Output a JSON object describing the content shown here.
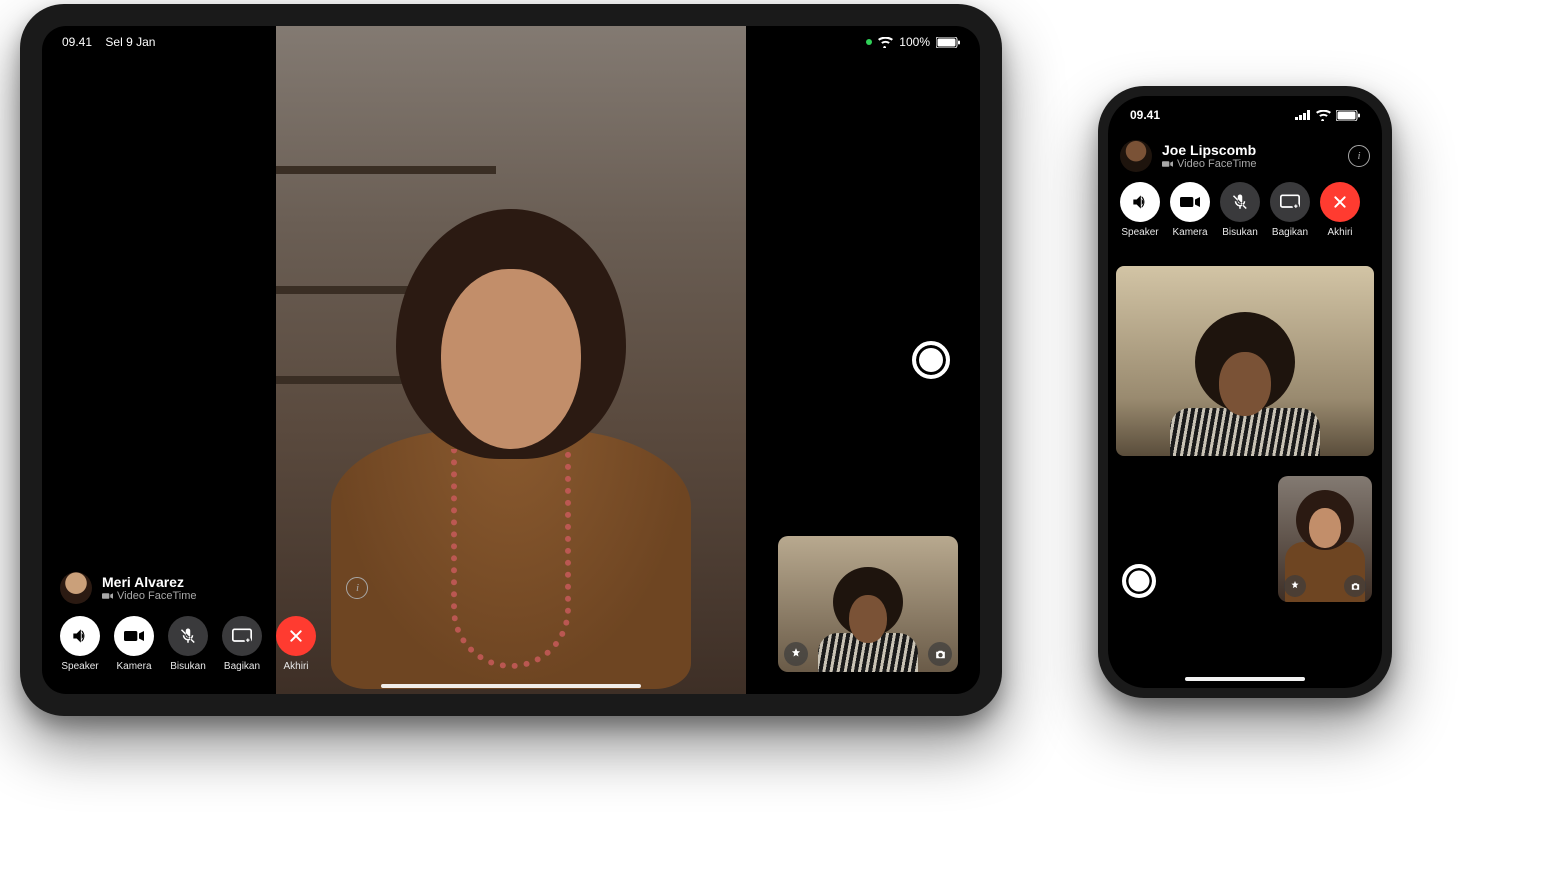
{
  "ipad": {
    "status": {
      "time": "09.41",
      "date": "Sel 9 Jan",
      "battery": "100%"
    },
    "caller": {
      "name": "Meri Alvarez",
      "subtitle": "Video FaceTime"
    },
    "controls": {
      "speaker": "Speaker",
      "camera": "Kamera",
      "mute": "Bisukan",
      "share": "Bagikan",
      "end": "Akhiri"
    }
  },
  "iphone": {
    "status": {
      "time": "09.41"
    },
    "caller": {
      "name": "Joe Lipscomb",
      "subtitle": "Video FaceTime"
    },
    "controls": {
      "speaker": "Speaker",
      "camera": "Kamera",
      "mute": "Bisukan",
      "share": "Bagikan",
      "end": "Akhiri"
    }
  }
}
